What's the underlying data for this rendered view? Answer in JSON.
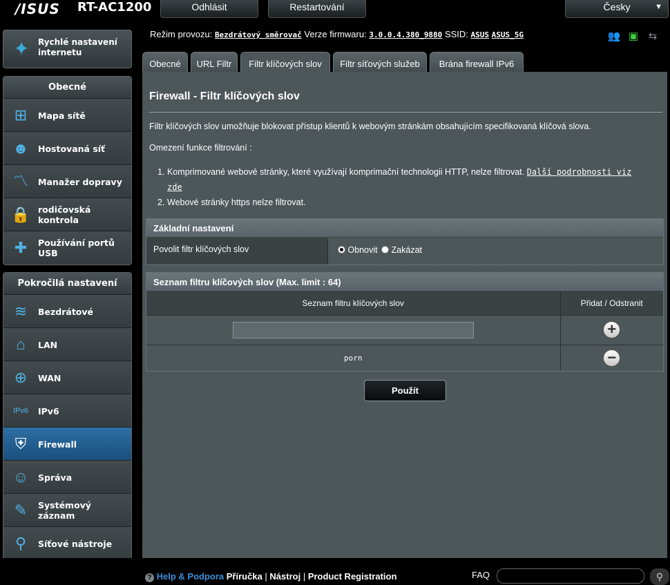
{
  "header": {
    "brand": "/ISUS",
    "model": "RT-AC1200",
    "logout_label": "Odhlásit",
    "restart_label": "Restartování",
    "language": "Česky"
  },
  "sidebar": {
    "quick_setup_label": "Rychlé nastavení internetu",
    "general": {
      "title": "Obecné",
      "items": [
        {
          "label": "Mapa sítě",
          "icon": "network-map-icon"
        },
        {
          "label": "Hostovaná síť",
          "icon": "guest-network-icon"
        },
        {
          "label": "Manažer dopravy",
          "icon": "traffic-manager-icon"
        },
        {
          "label": "rodičovská kontrola",
          "icon": "parental-control-icon"
        },
        {
          "label": "Používání portů USB",
          "icon": "usb-application-icon"
        }
      ]
    },
    "advanced": {
      "title": "Pokročilá nastavení",
      "items": [
        {
          "label": "Bezdrátové",
          "icon": "wireless-icon"
        },
        {
          "label": "LAN",
          "icon": "home-icon"
        },
        {
          "label": "WAN",
          "icon": "globe-icon"
        },
        {
          "label": "IPv6",
          "icon": "ipv6-icon"
        },
        {
          "label": "Firewall",
          "icon": "shield-icon",
          "active": true
        },
        {
          "label": "Správa",
          "icon": "administration-icon"
        },
        {
          "label": "Systémový záznam",
          "icon": "system-log-icon"
        },
        {
          "label": "Síťové nástroje",
          "icon": "network-tools-icon"
        }
      ]
    }
  },
  "info": {
    "mode_label": "Režim provozu:",
    "mode_value": "Bezdrátový směrovač",
    "firmware_label": "Verze firmwaru:",
    "firmware_value": "3.0.0.4.380_9880",
    "ssid_label": "SSID:",
    "ssid_1": "ASUS",
    "ssid_2": "ASUS_5G"
  },
  "tabs": [
    {
      "label": "Obecné"
    },
    {
      "label": "URL Filtr"
    },
    {
      "label": "Filtr klíčových slov",
      "active": true
    },
    {
      "label": "Filtr síťových služeb"
    },
    {
      "label": "Brána firewall IPv6"
    }
  ],
  "content": {
    "title": "Firewall - Filtr klíčových slov",
    "description": "Filtr klíčových slov umožňuje blokovat přístup klientů k webovým stránkám obsahujícím specifikovaná klíčová slova.",
    "limitations_title": "Omezení funkce filtrování :",
    "limitations": [
      {
        "num": "1.",
        "text": "Komprimované webové stránky, které využívají komprimační technologii HTTP, nelze filtrovat.",
        "link": "Další podrobnosti viz zde"
      },
      {
        "num": "2.",
        "text": "Webové stránky https nelze filtrovat."
      }
    ],
    "basic": {
      "title": "Základní nastavení",
      "enable_label": "Povolit filtr klíčových slov",
      "option_on": "Obnovit",
      "option_off": "Zakázat",
      "selected": "Obnovit"
    },
    "list": {
      "title": "Seznam filtru klíčových slov (Max. limit : 64)",
      "col_keyword": "Seznam filtru klíčových slov",
      "col_action": "Přidat / Odstranit",
      "new_value": "",
      "entries": [
        "porn"
      ]
    },
    "apply_label": "Použít"
  },
  "footer": {
    "help_label": "Help & Podpora",
    "manual": "Příručka",
    "utility": "Nástroj",
    "registration": "Product Registration",
    "faq": "FAQ"
  }
}
